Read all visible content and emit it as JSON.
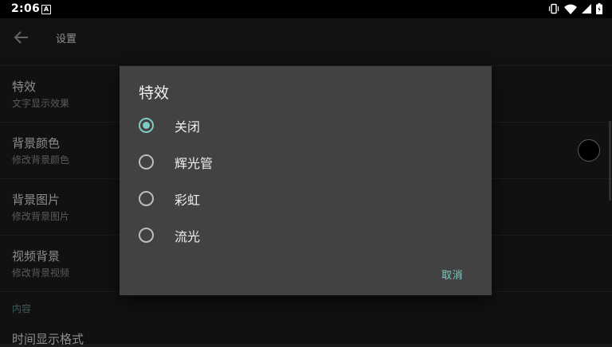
{
  "status_bar": {
    "time": "2:06",
    "notification_badge": "A",
    "icons": [
      "vibrate-icon",
      "wifi-icon",
      "signal-icon",
      "battery-icon"
    ]
  },
  "toolbar": {
    "title": "设置",
    "back_icon": "arrow-left-icon"
  },
  "settings": {
    "items": [
      {
        "title": "特效",
        "subtitle": "文字显示效果"
      },
      {
        "title": "背景颜色",
        "subtitle": "修改背景颜色"
      },
      {
        "title": "背景图片",
        "subtitle": "修改背景图片"
      },
      {
        "title": "视频背景",
        "subtitle": "修改背景视频"
      }
    ],
    "background_color_value": "#000000",
    "section_header": "内容",
    "last_item_title": "时间显示格式"
  },
  "dialog": {
    "title": "特效",
    "options": [
      {
        "label": "关闭",
        "selected": true
      },
      {
        "label": "辉光管",
        "selected": false
      },
      {
        "label": "彩虹",
        "selected": false
      },
      {
        "label": "流光",
        "selected": false
      }
    ],
    "cancel_label": "取消"
  },
  "colors": {
    "accent": "#80cbc4",
    "dialog_bg": "#424242",
    "app_bg": "#1b1b1b"
  }
}
